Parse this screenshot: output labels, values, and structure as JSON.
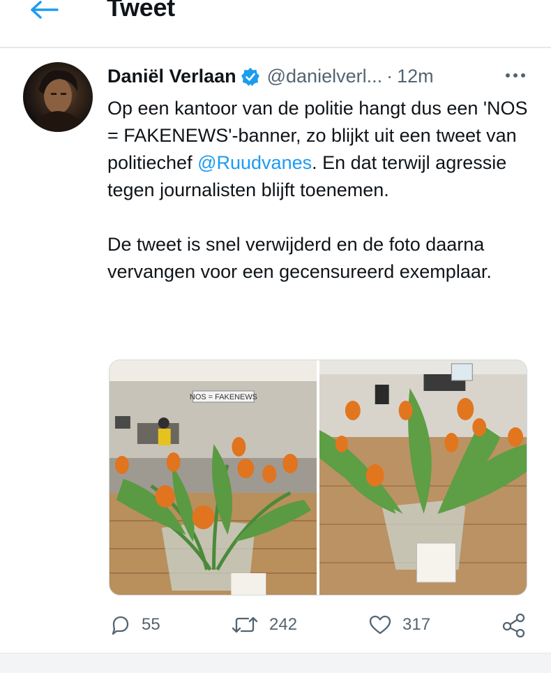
{
  "header": {
    "title": "Tweet"
  },
  "tweet": {
    "author_name": "Daniël Verlaan",
    "handle": "@danielverl...",
    "separator": "·",
    "time": "12m",
    "paragraph1_before": "Op een kantoor van de politie hangt dus een 'NOS = FAKENEWS'-banner, zo blijkt uit een tweet van politiechef ",
    "mention": "@Ruudvanes",
    "paragraph1_after": ". En dat terwijl agressie tegen journalisten blijft toenemen.",
    "paragraph2": "De tweet is snel verwijderd en de foto daarna vervangen voor een gecensureerd exemplaar.",
    "banner_text": "NOS = FAKENEWS"
  },
  "actions": {
    "replies": "55",
    "retweets": "242",
    "likes": "317"
  },
  "icons": {
    "back": "arrow-left-icon",
    "verified": "verified-badge-icon",
    "more": "more-horizontal-icon",
    "reply": "reply-icon",
    "retweet": "retweet-icon",
    "like": "heart-icon",
    "share": "share-icon"
  },
  "colors": {
    "accent": "#1d9bf0",
    "text": "#0f1419",
    "muted": "#536471"
  }
}
